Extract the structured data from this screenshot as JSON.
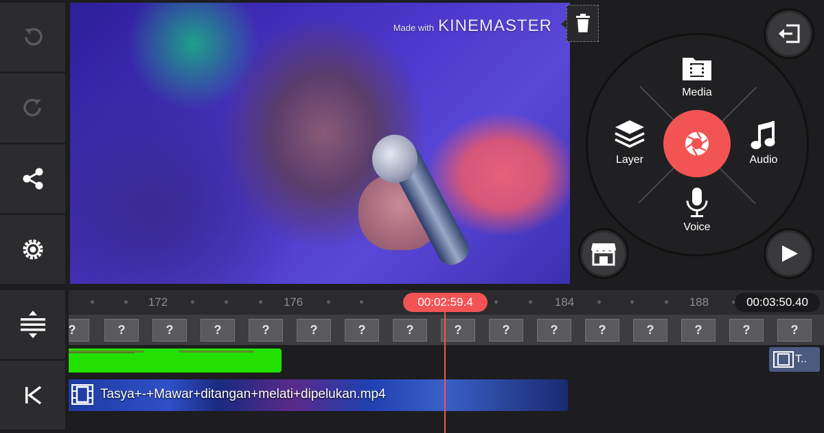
{
  "toolbar": {
    "buttons": [
      {
        "name": "undo",
        "icon": "undo-icon"
      },
      {
        "name": "redo",
        "icon": "redo-icon"
      },
      {
        "name": "share",
        "icon": "share-icon"
      },
      {
        "name": "settings",
        "icon": "gear-icon"
      },
      {
        "name": "adjust-track-height",
        "icon": "expand-vertical-icon"
      },
      {
        "name": "jump-to-start",
        "icon": "skip-to-start-icon"
      }
    ]
  },
  "preview": {
    "watermark_prefix": "Made with",
    "watermark_brand": "KINEMASTER"
  },
  "wheel_menu": {
    "media_label": "Media",
    "layer_label": "Layer",
    "audio_label": "Audio",
    "voice_label": "Voice"
  },
  "timeline": {
    "ruler_labels": [
      "172",
      "176",
      "184",
      "188"
    ],
    "playhead_time": "00:02:59.4",
    "total_time": "00:03:50.40",
    "video_clip_name": "Tasya+-+Mawar+ditangan+melati+dipelukan.mp4",
    "right_clip_label": "T..",
    "thumb_placeholder": "?"
  },
  "colors": {
    "accent": "#f25454",
    "audio_clip": "#22e000",
    "panel": "#2c2c2f"
  }
}
